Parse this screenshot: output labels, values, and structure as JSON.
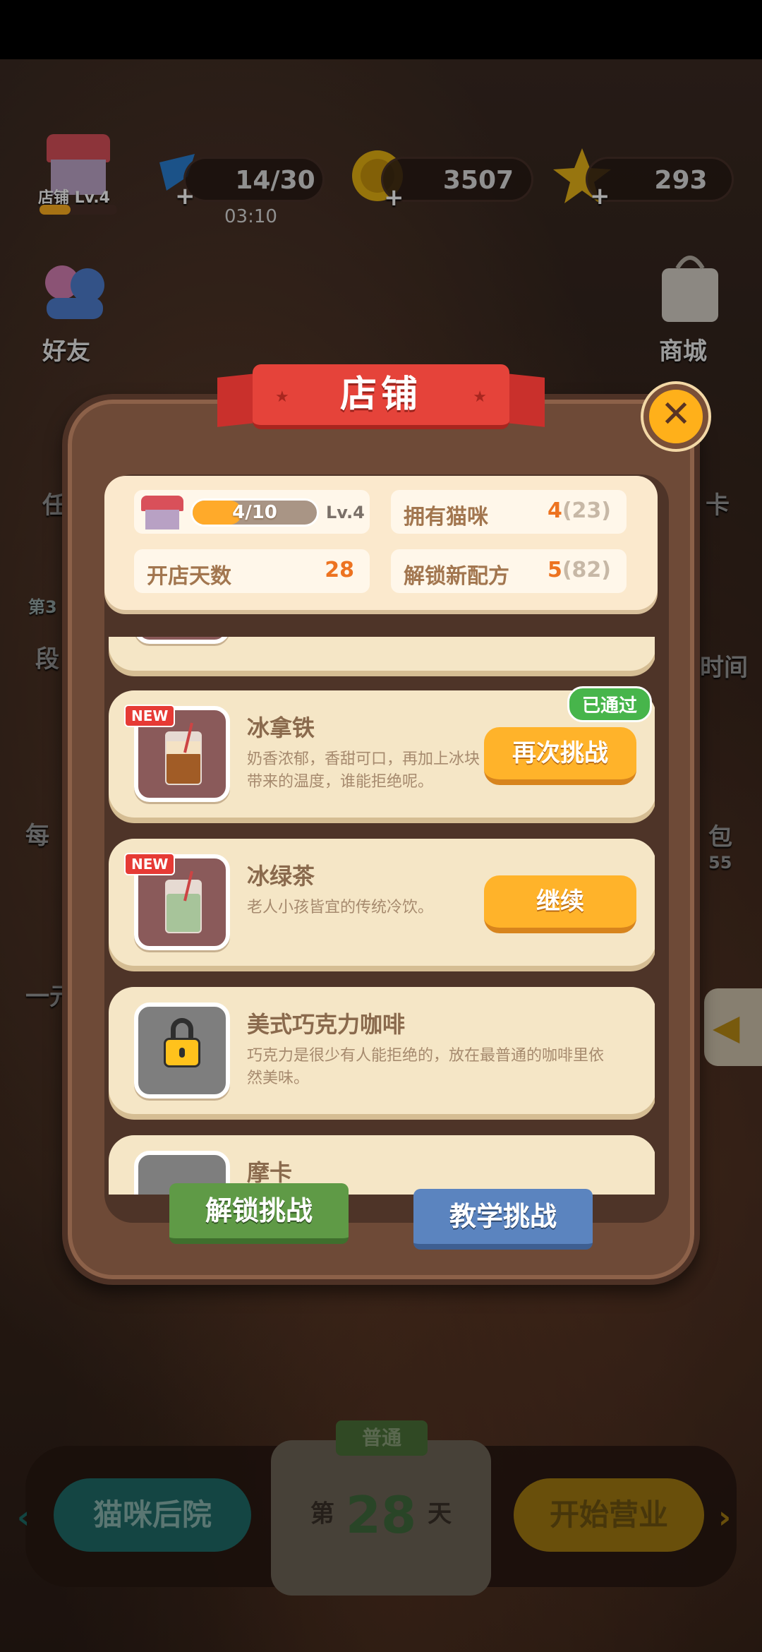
{
  "top_bar": {
    "shop_label": "店铺 Lv.4",
    "energy": "14/30",
    "energy_timer": "03:10",
    "coins": "3507",
    "stars": "293"
  },
  "background_labels": {
    "friends": "好友",
    "shop": "商城",
    "left_1": "任",
    "left_2": "段",
    "left_3": "每",
    "left_4": "一元",
    "right_1": "卡",
    "right_2": "时间",
    "right_3": "包",
    "right_3_sub": "55",
    "left_badge": "第3"
  },
  "modal": {
    "title": "店铺",
    "close_icon": "close-x-icon",
    "stats": {
      "progress_text": "4/10",
      "progress_fraction": 0.4,
      "level": "Lv.4",
      "cats_label": "拥有猫咪",
      "cats_value": "4",
      "cats_total": "(23)",
      "days_label": "开店天数",
      "days_value": "28",
      "recipes_label": "解锁新配方",
      "recipes_value": "5",
      "recipes_total": "(82)"
    },
    "recipes": [
      {
        "name": "冰拿铁",
        "desc": "奶香浓郁，香甜可口，再加上冰块带来的温度，谁能拒绝呢。",
        "badge": "NEW",
        "status": "已通过",
        "action": "再次挑战"
      },
      {
        "name": "冰绿茶",
        "desc": "老人小孩皆宜的传统冷饮。",
        "badge": "NEW",
        "action": "继续"
      },
      {
        "name": "美式巧克力咖啡",
        "desc": "巧克力是很少有人能拒绝的，放在最普通的咖啡里依然美味。",
        "locked": true
      },
      {
        "name": "摩卡"
      }
    ],
    "tabs": {
      "unlock": "解锁挑战",
      "tutorial": "教学挑战"
    }
  },
  "bottom_bar": {
    "backyard": "猫咪后院",
    "mode": "普通",
    "day_prefix": "第",
    "day_number": "28",
    "day_suffix": "天",
    "start": "开始营业"
  },
  "colors": {
    "accent_orange": "#ffb32a",
    "ribbon_red": "#e5433a",
    "passed_green": "#47b54b",
    "tab_green": "#5f9a46",
    "tab_blue": "#5b84bf"
  }
}
